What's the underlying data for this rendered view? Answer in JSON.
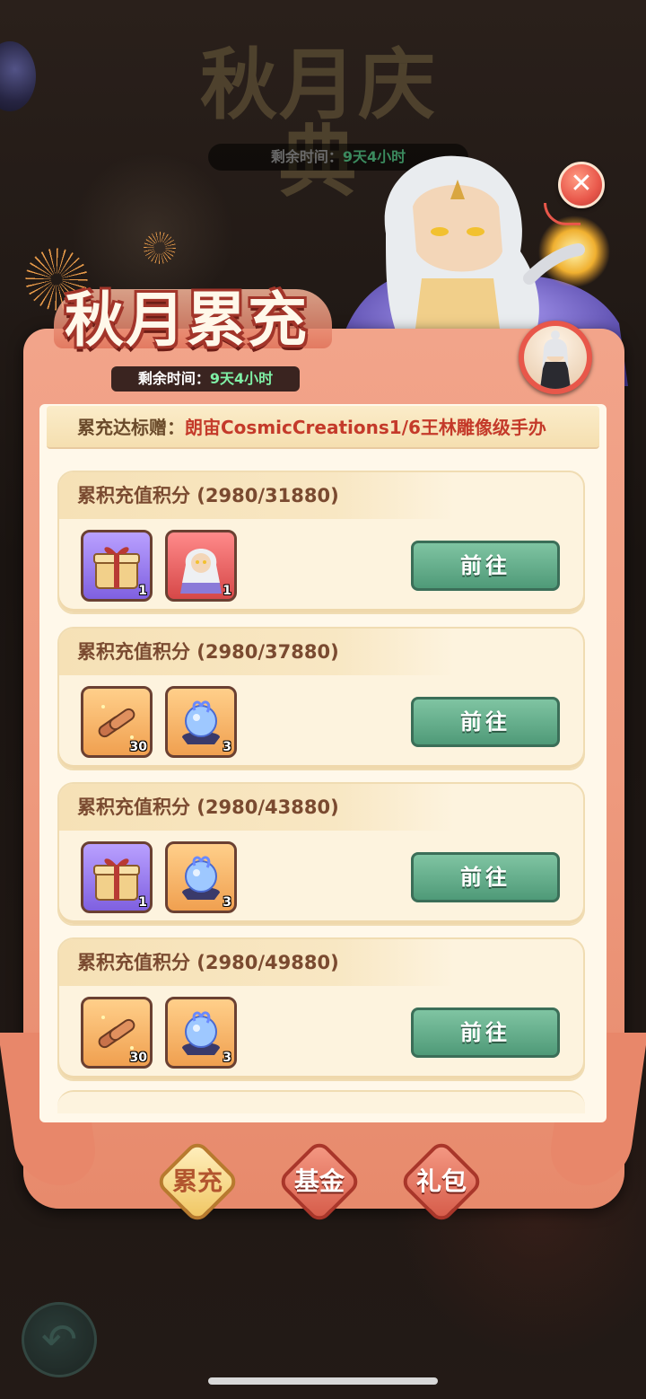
{
  "background": {
    "title": "秋月庆典",
    "timer_label": "剩余时间：",
    "timer_value": "9天4小时"
  },
  "banner": {
    "title": "秋月累充",
    "timer_label": "剩余时间：",
    "timer_value": "9天4小时"
  },
  "award": {
    "label": "累充达标赠：",
    "gift": "朗宙CosmicCreations1/6王林雕像级手办"
  },
  "cards": [
    {
      "title": "累积充值积分 (2980/31880)",
      "items": [
        {
          "icon": "gift-chest-icon",
          "qty": "1",
          "rarity": "purple"
        },
        {
          "icon": "hero-portrait-icon",
          "qty": "1",
          "rarity": "red"
        }
      ],
      "button": "前往"
    },
    {
      "title": "累积充值积分 (2980/37880)",
      "items": [
        {
          "icon": "scroll-icon",
          "qty": "30",
          "rarity": "orange"
        },
        {
          "icon": "spirit-orb-icon",
          "qty": "3",
          "rarity": "orange"
        }
      ],
      "button": "前往"
    },
    {
      "title": "累积充值积分 (2980/43880)",
      "items": [
        {
          "icon": "gift-chest-icon",
          "qty": "1",
          "rarity": "purple"
        },
        {
          "icon": "spirit-orb-icon",
          "qty": "3",
          "rarity": "orange"
        }
      ],
      "button": "前往"
    },
    {
      "title": "累积充值积分 (2980/49880)",
      "items": [
        {
          "icon": "scroll-icon",
          "qty": "30",
          "rarity": "orange"
        },
        {
          "icon": "spirit-orb-icon",
          "qty": "3",
          "rarity": "orange"
        }
      ],
      "button": "前往"
    }
  ],
  "tabs": [
    {
      "label": "累充",
      "active": true
    },
    {
      "label": "基金",
      "active": false
    },
    {
      "label": "礼包",
      "active": false
    }
  ],
  "colors": {
    "accent_red": "#e8574a",
    "button_green": "#4f9a78",
    "panel_cream": "#fff8ea"
  }
}
